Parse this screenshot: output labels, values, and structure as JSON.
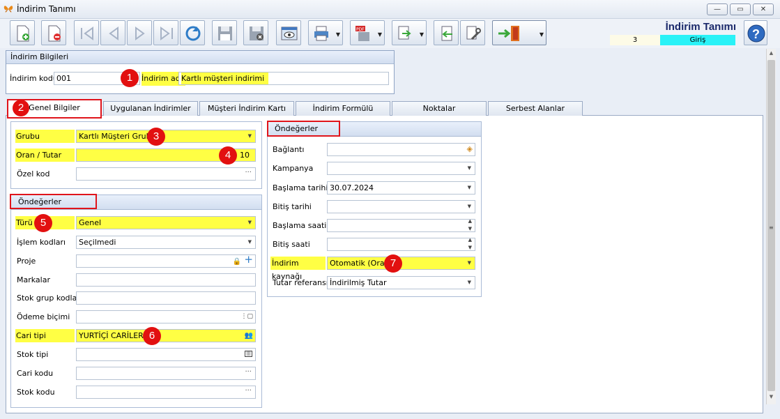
{
  "window": {
    "title": "İndirim Tanımı",
    "min": "—",
    "max": "▭",
    "close": "✕"
  },
  "toolbar": {
    "buttons": [
      {
        "name": "new-record-button",
        "icon": "new-document-icon"
      },
      {
        "name": "delete-record-button",
        "icon": "delete-document-icon"
      },
      {
        "name": "first-record-button",
        "icon": "first-icon"
      },
      {
        "name": "prev-record-button",
        "icon": "prev-icon"
      },
      {
        "name": "next-record-button",
        "icon": "next-icon"
      },
      {
        "name": "last-record-button",
        "icon": "last-icon"
      },
      {
        "name": "refresh-button",
        "icon": "refresh-icon"
      },
      {
        "name": "save-button",
        "icon": "save-icon"
      },
      {
        "name": "save-cancel-button",
        "icon": "save-cancel-icon"
      },
      {
        "name": "preview-button",
        "icon": "eye-icon"
      },
      {
        "name": "print-button",
        "icon": "printer-icon"
      },
      {
        "name": "pdf-button",
        "icon": "pdf-icon"
      },
      {
        "name": "export-button",
        "icon": "export-icon"
      },
      {
        "name": "import-button",
        "icon": "import-icon"
      },
      {
        "name": "tools-button",
        "icon": "wrench-icon"
      },
      {
        "name": "exit-button",
        "icon": "door-exit-icon"
      }
    ]
  },
  "header": {
    "title": "İndirim Tanımı",
    "number": "3",
    "mode": "Giriş"
  },
  "indirim_bilgileri": {
    "heading": "İndirim Bilgileri",
    "kod_label": "İndirim kodu",
    "kod_value": "001",
    "adi_label": "İndirim adı",
    "adi_value": "Kartlı müşteri indirimi"
  },
  "tabs": [
    "Genel Bilgiler",
    "Uygulanan İndirimler",
    "Müşteri İndirim Kartı",
    "İndirim Formülü",
    "Noktalar",
    "Serbest Alanlar"
  ],
  "genel": {
    "grubu_label": "Grubu",
    "grubu_value": "Kartlı Müşteri Grubu",
    "oran_label": "Oran / Tutar",
    "oran_value": "10",
    "ozel_label": "Özel kod",
    "ozel_value": ""
  },
  "left_ondegerler": {
    "heading": "Öndeğerler",
    "fields": [
      {
        "label": "Türü",
        "value": "Genel"
      },
      {
        "label": "İşlem kodları",
        "value": "Seçilmedi"
      },
      {
        "label": "Proje",
        "value": ""
      },
      {
        "label": "Markalar",
        "value": ""
      },
      {
        "label": "Stok grup kodları",
        "value": ""
      },
      {
        "label": "Ödeme biçimi",
        "value": ""
      },
      {
        "label": "Cari tipi",
        "value": "YURTİÇİ CARİLER"
      },
      {
        "label": "Stok tipi",
        "value": ""
      },
      {
        "label": "Cari kodu",
        "value": ""
      },
      {
        "label": "Stok kodu",
        "value": ""
      }
    ]
  },
  "right_ondegerler": {
    "heading": "Öndeğerler",
    "fields": [
      {
        "label": "Bağlantı",
        "value": ""
      },
      {
        "label": "Kampanya",
        "value": ""
      },
      {
        "label": "Başlama tarihi",
        "value": "30.07.2024"
      },
      {
        "label": "Bitiş tarihi",
        "value": ""
      },
      {
        "label": "Başlama saati",
        "value": ""
      },
      {
        "label": "Bitiş saati",
        "value": ""
      },
      {
        "label": "İndirim kaynağı",
        "value": "Otomatik (Oran)"
      },
      {
        "label": "Tutar referansı",
        "value": "İndirilmiş Tutar"
      }
    ]
  },
  "badges": [
    "1",
    "2",
    "3",
    "4",
    "5",
    "6",
    "7"
  ],
  "colors": {
    "highlight": "#ffff44",
    "badge": "#e21010",
    "mode_bg": "#2af2f7",
    "annot_border": "#e0141b"
  }
}
